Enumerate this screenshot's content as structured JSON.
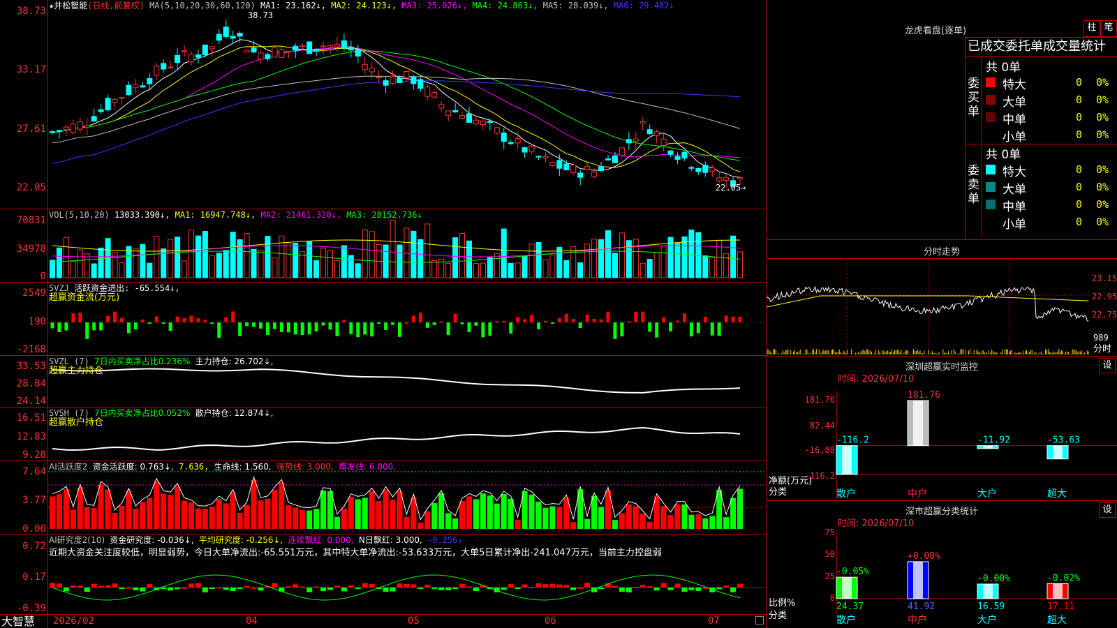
{
  "colors": {
    "up": "#ff3232",
    "down": "#00ffff",
    "grid": "#c00000",
    "ma1": "#ffffff",
    "ma2": "#ffff00",
    "ma3": "#ff00ff",
    "ma4": "#00ff00",
    "ma5": "#c0c0c0",
    "ma6": "#3c3cff"
  },
  "stock": {
    "name": "★井松智能",
    "mode": "(日线,前复权)"
  },
  "price_panel": {
    "indicator": "MA(5,10,20,30,60,120)",
    "ma1": "MA1: 23.162↓,",
    "ma2": "MA2: 24.123↓,",
    "ma3": "MA3: 25.026↓,",
    "ma4": "MA4: 24.863↓,",
    "ma5": "MA5: 28.039↓,",
    "ma6": "MA6: 29.482↓",
    "y_ticks": [
      "38.73",
      "33.17",
      "27.61",
      "22.05"
    ],
    "high_label": "38.73",
    "low_label": "22.05→",
    "ylim": [
      20.5,
      39.5
    ]
  },
  "vol_panel": {
    "indicator": "VOL(5,10,20)",
    "value": "13033.390↓,",
    "ma1": "MA1: 16947.748↓,",
    "ma2": "MA2: 21461.320↓,",
    "ma3": "MA3: 28152.736↓",
    "y_ticks": [
      "70831",
      "34978",
      "0"
    ]
  },
  "svzj_panel": {
    "indicator": "SVZJ",
    "label": "活跃资金进出: -65.554↓,",
    "label2": "超赢资金流(万元)",
    "y_ticks": [
      "2549",
      "190",
      "-2168"
    ]
  },
  "svzl_panel": {
    "indicator": "SVZL (7)",
    "label": "7日内买卖净占比0.236%",
    "label_b": "主力持仓: 26.702↓,",
    "label2": "超赢主力持仓",
    "y_ticks": [
      "33.53",
      "28.84",
      "24.14"
    ]
  },
  "svsh_panel": {
    "indicator": "SVSH (7)",
    "label": "7日内买卖净占比0.052%",
    "label_b": "散户持仓: 12.874↓,",
    "label2": "超赢散户持仓",
    "y_ticks": [
      "16.51",
      "12.83",
      "9.28"
    ]
  },
  "ai_active_panel": {
    "indicator": "AI活跃度2",
    "a": "资金活跃度: 0.763↓,",
    "b": "7.636,",
    "c": "生命线: 1.560,",
    "d": "强势线: 3.000,",
    "e": "爆发线: 6.000,",
    "y_ticks": [
      "7.64",
      "3.77",
      "0.00"
    ]
  },
  "ai_research_panel": {
    "indicator": "AI研究度2(10)",
    "a": "资金研究度: -0.036↓,",
    "b": "平均研究度: -0.256↓,",
    "c": "连续飘红: 0.000,",
    "d": "N日飘红: 3.000,",
    "e": "-0.256↓",
    "y_ticks": [
      "0.72",
      "0.17",
      "-0.39"
    ]
  },
  "commentary": "近期大资金关注度较低，明显弱势，今日大单净流出:-65.551万元，其中特大单净流出:-53.633万元，大单5日累计净出-241.047万元，当前主力控盘弱",
  "date_axis": {
    "labels": [
      "2026/02",
      "04",
      "05",
      "06",
      "07"
    ]
  },
  "brand": "大智慧",
  "dragon_panel": {
    "title": "龙虎看盘(逐单)",
    "btn_zhu": "柱",
    "btn_bi": "笔",
    "header": "已成交委托单成交量统计",
    "buy": {
      "side": "委买单",
      "total": "共 0单",
      "rows": [
        {
          "label": "特大",
          "value": "0",
          "pct": "0%",
          "color": "#ff0000"
        },
        {
          "label": "大单",
          "value": "0",
          "pct": "0%",
          "color": "#8b0000"
        },
        {
          "label": "中单",
          "value": "0",
          "pct": "0%",
          "color": "#6a0000"
        },
        {
          "label": "小单",
          "value": "0",
          "pct": "0%",
          "color": ""
        }
      ]
    },
    "sell": {
      "side": "委卖单",
      "total": "共 0单",
      "rows": [
        {
          "label": "特大",
          "value": "0",
          "pct": "0%",
          "color": "#00ffff"
        },
        {
          "label": "大单",
          "value": "0",
          "pct": "0%",
          "color": "#008b8b"
        },
        {
          "label": "中单",
          "value": "0",
          "pct": "0%",
          "color": "#007070"
        },
        {
          "label": "小单",
          "value": "0",
          "pct": "0%",
          "color": ""
        }
      ]
    }
  },
  "intraday_panel": {
    "title": "分时走势",
    "prices": [
      "23.15",
      "22.95",
      "22.75"
    ],
    "vol": "989",
    "vol_label": "分时"
  },
  "sz_monitor": {
    "title": "深圳超赢实时监控",
    "btn": "设",
    "time": "时间: 2026/07/10",
    "y_ticks": [
      "181.76",
      "82.44",
      "-16.88",
      "-116.2"
    ],
    "ylabel": "净额(万元)",
    "xlabel": "分类",
    "chart_data": {
      "type": "bar",
      "categories": [
        "散户",
        "中户",
        "大户",
        "超大"
      ],
      "values": [
        -116.2,
        181.76,
        -11.92,
        -53.63
      ],
      "labels": [
        "-116.2",
        "181.76",
        "-11.92",
        "-53.63"
      ],
      "ylim": [
        -116.2,
        181.76
      ]
    }
  },
  "sz_stats": {
    "title": "深市超赢分类统计",
    "btn": "设",
    "time": "时间: 2026/07/10",
    "y_ticks": [
      "75",
      "50",
      "25",
      "0"
    ],
    "ylabel": "比例%",
    "xlabel": "分类",
    "chart_data": {
      "type": "bar",
      "categories": [
        "散户",
        "中户",
        "大户",
        "超大"
      ],
      "values": [
        24.37,
        41.92,
        16.59,
        17.11
      ],
      "changes": [
        "-0.05%",
        "+0.08%",
        "-0.00%",
        "-0.02%"
      ],
      "ylim": [
        0,
        75
      ]
    }
  }
}
